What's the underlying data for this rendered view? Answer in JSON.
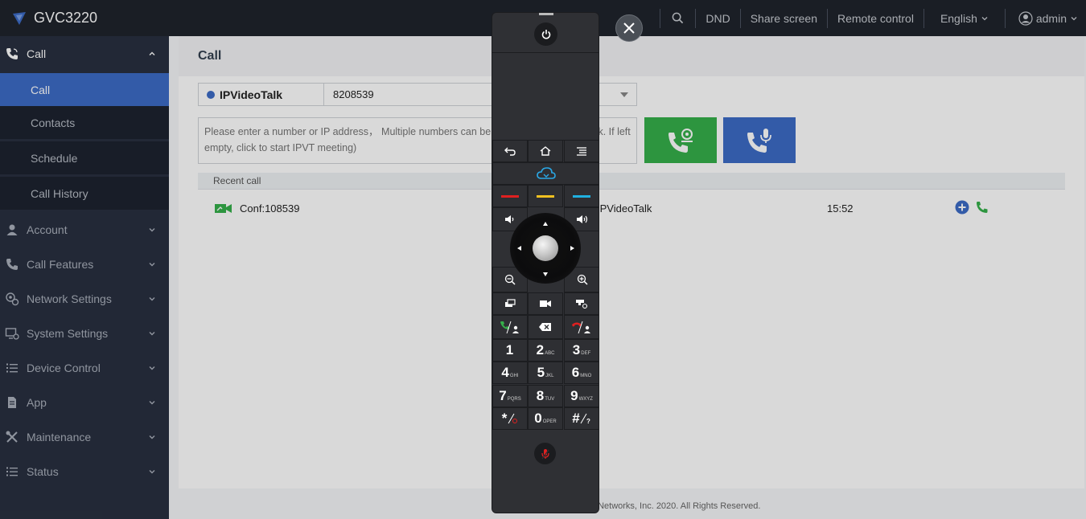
{
  "brand": {
    "name": "GVC3220"
  },
  "topnav": {
    "dnd": "DND",
    "share": "Share screen",
    "remote": "Remote control",
    "language": "English",
    "user": "admin"
  },
  "sidebar": {
    "call": "Call",
    "subs": [
      "Call",
      "Contacts",
      "Schedule",
      "Call History"
    ],
    "items": [
      "Account",
      "Call Features",
      "Network Settings",
      "System Settings",
      "Device Control",
      "App",
      "Maintenance",
      "Status"
    ]
  },
  "main": {
    "title": "Call",
    "account_name": "IPVideoTalk",
    "account_number": "8208539",
    "dial_placeholder": "Please enter a number or IP address， Multiple numbers can be separated by \",\" or blank. If left empty, click to start IPVT meeting)",
    "recent_header": "Recent call",
    "recent": [
      {
        "name": "Conf:108539",
        "account": "IPVideoTalk",
        "time": "15:52"
      }
    ],
    "footer": "Copyright © Grandstream Networks, Inc. 2020. All Rights Reserved."
  },
  "remote": {
    "digits": [
      {
        "d": "1",
        "s": ""
      },
      {
        "d": "2",
        "s": "ABC"
      },
      {
        "d": "3",
        "s": "DEF"
      },
      {
        "d": "4",
        "s": "GHI"
      },
      {
        "d": "5",
        "s": "JKL"
      },
      {
        "d": "6",
        "s": "MNO"
      },
      {
        "d": "7",
        "s": "PQRS"
      },
      {
        "d": "8",
        "s": "TUV"
      },
      {
        "d": "9",
        "s": "WXYZ"
      },
      {
        "d": "*",
        "s": ""
      },
      {
        "d": "0",
        "s": "OPER"
      },
      {
        "d": "#",
        "s": ""
      }
    ],
    "colors": {
      "red": "#e02020",
      "yellow": "#f0c020",
      "blue": "#20b0e0"
    }
  },
  "colors": {
    "accent": "#3d6bc6",
    "green": "#36b04a",
    "sidebar": "#283040"
  }
}
